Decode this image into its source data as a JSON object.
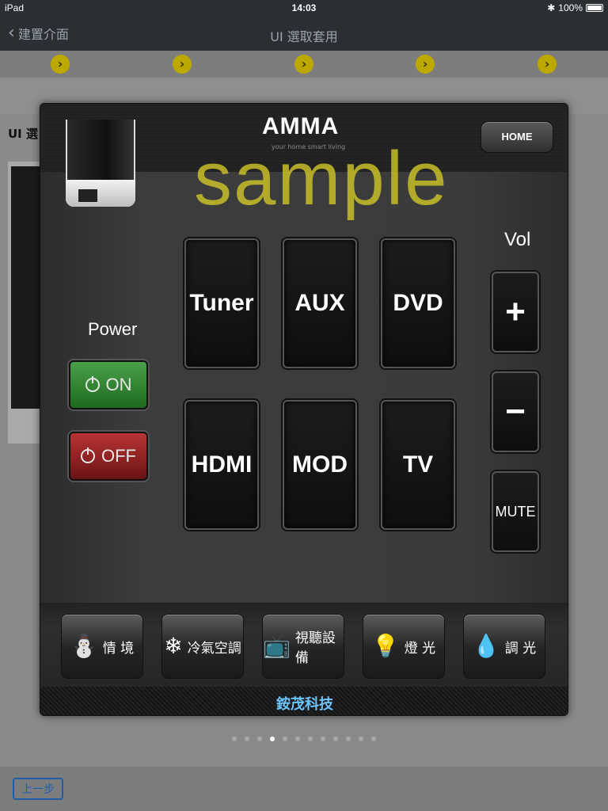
{
  "status": {
    "device": "iPad",
    "time": "14:03",
    "battery": "100%"
  },
  "nav": {
    "back_label": "建置介面",
    "title": "UI 選取套用"
  },
  "steps": {
    "arrow_icon": "chevron-right-icon"
  },
  "underlying": {
    "title_fragment": "UI 選"
  },
  "pager": {
    "count": 12,
    "active_index": 3
  },
  "bottom": {
    "prev_label": "上一步"
  },
  "panel": {
    "brand": "AMMA",
    "brand_sub": "your home smart living",
    "watermark": "sample",
    "home_label": "HOME",
    "power": {
      "label": "Power",
      "on_label": "ON",
      "off_label": "OFF",
      "on_color": "#2f8a2f",
      "off_color": "#a42424"
    },
    "sources": [
      "Tuner",
      "AUX",
      "DVD",
      "HDMI",
      "MOD",
      "TV"
    ],
    "volume": {
      "label": "Vol",
      "up": "+",
      "down": "−",
      "mute": "MUTE"
    },
    "categories": [
      {
        "label": "情 境",
        "icon": "scene-icon",
        "glyph": "⛄"
      },
      {
        "label": "冷氣空調",
        "icon": "snowflake-icon",
        "glyph": "❄"
      },
      {
        "label": "視聽設備",
        "icon": "tv-icon",
        "glyph": "📺"
      },
      {
        "label": "燈 光",
        "icon": "lightbulb-icon",
        "glyph": "💡"
      },
      {
        "label": "調 光",
        "icon": "dimmer-icon",
        "glyph": "💧"
      }
    ],
    "footer": "銨茂科技"
  }
}
